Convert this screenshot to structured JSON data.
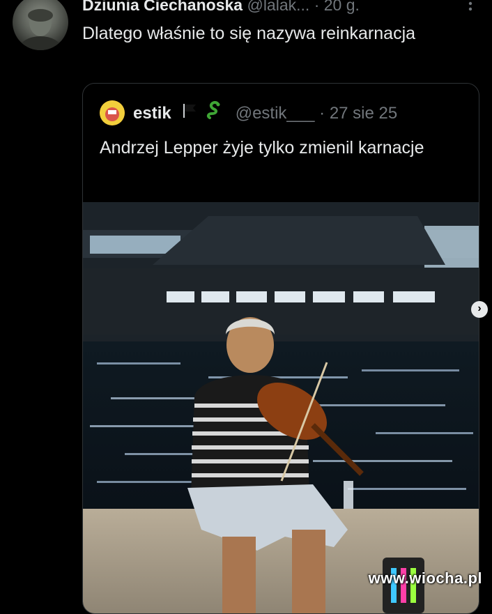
{
  "tweet": {
    "author_name": "Dziunia Ciechanoska",
    "handle": "@lalak...",
    "time": "· 20 g.",
    "text": "Dlatego właśnie to się nazywa reinkarnacja",
    "more_icon": "more-vertical-icon"
  },
  "quote": {
    "author_name": "estik",
    "handle": "@estik___",
    "time": "· 27 sie 25",
    "text": "Andrzej Lepper żyje tylko zmienil karnacje",
    "flag_icon": "black-flag-icon",
    "emoji_icon": "snake-icon"
  },
  "carousel": {
    "next_icon": "chevron-right-icon",
    "next_glyph": "›"
  },
  "watermark": "www.wiocha.pl",
  "colors": {
    "background": "#000000",
    "text_primary": "#e7e9ea",
    "text_muted": "#71767b",
    "border": "#2f3336"
  }
}
